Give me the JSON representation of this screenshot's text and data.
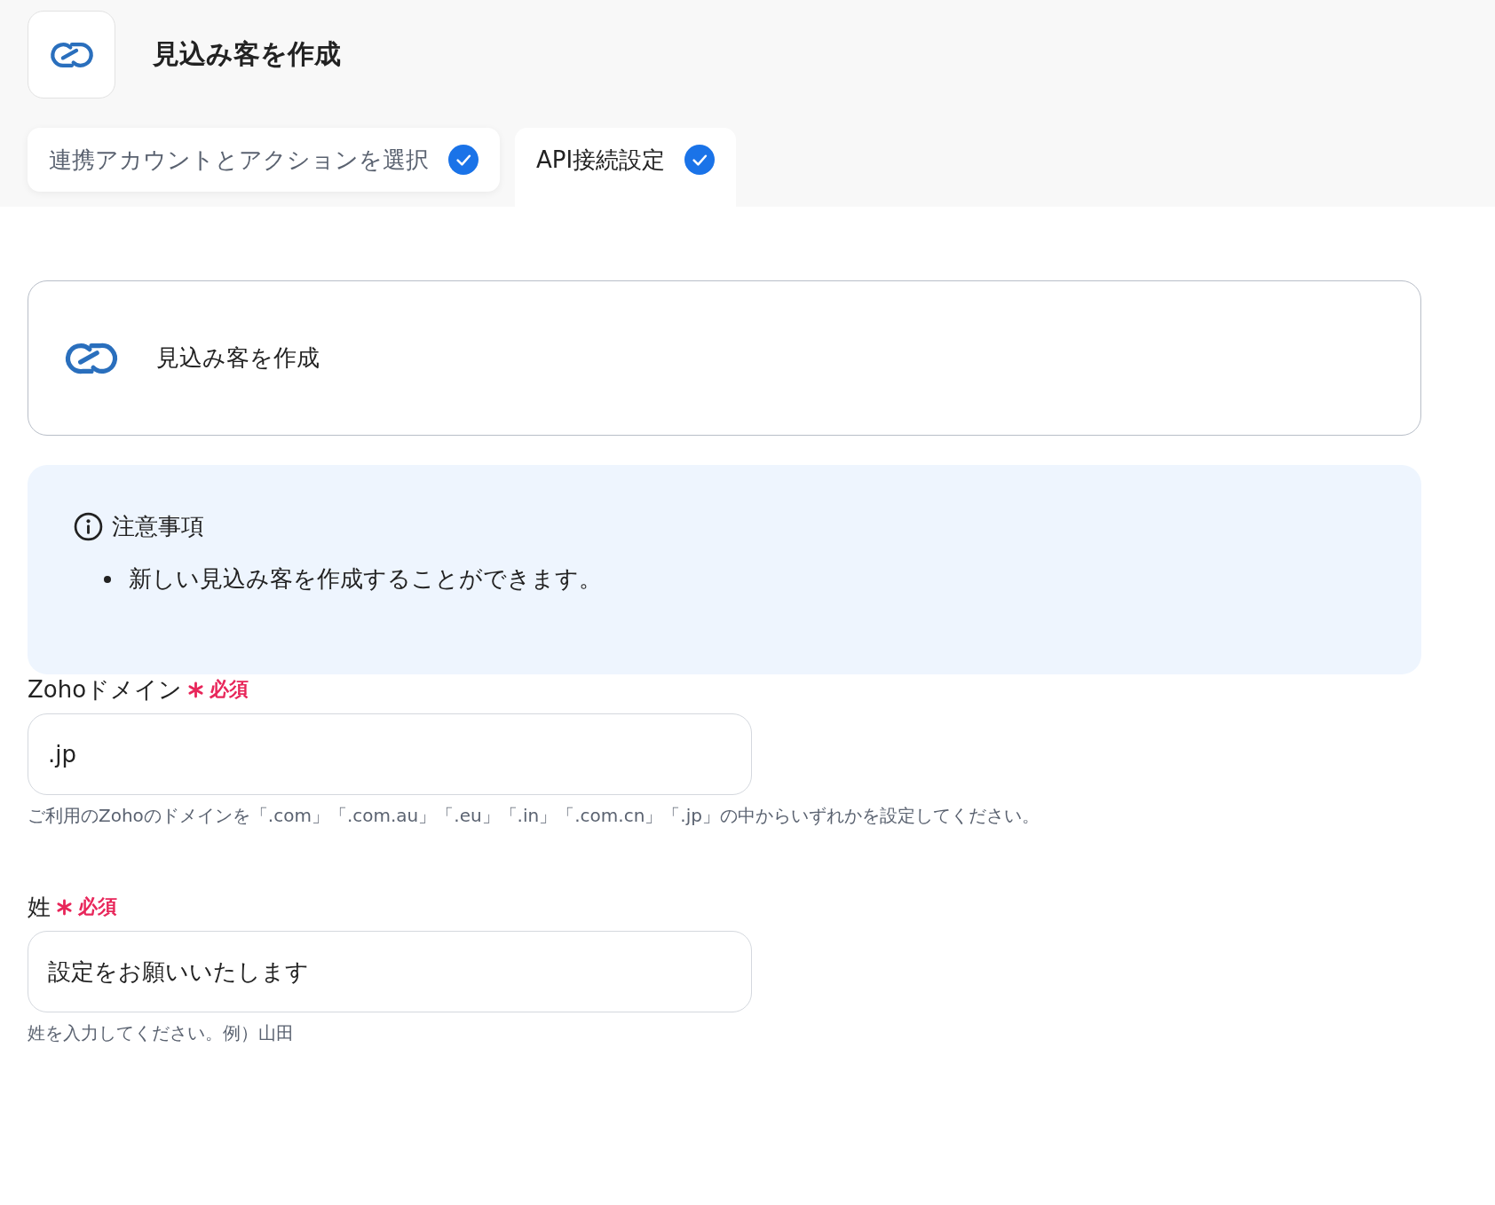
{
  "header": {
    "title": "見込み客を作成"
  },
  "tabs": [
    {
      "label": "連携アカウントとアクションを選択",
      "selected": false,
      "completed": true
    },
    {
      "label": "API接続設定",
      "selected": true,
      "completed": true
    }
  ],
  "action_card": {
    "title": "見込み客を作成"
  },
  "notice": {
    "heading": "注意事項",
    "items": [
      "新しい見込み客を作成することができます。"
    ]
  },
  "fields": [
    {
      "label": "Zohoドメイン",
      "required": true,
      "required_text": "必須",
      "value": ".jp",
      "help": "ご利用のZohoのドメインを「.com」「.com.au」「.eu」「.in」「.com.cn」「.jp」の中からいずれかを設定してください。"
    },
    {
      "label": "姓",
      "required": true,
      "required_text": "必須",
      "value": "設定をお願いいたします",
      "help": "姓を入力してください。例）山田"
    }
  ]
}
